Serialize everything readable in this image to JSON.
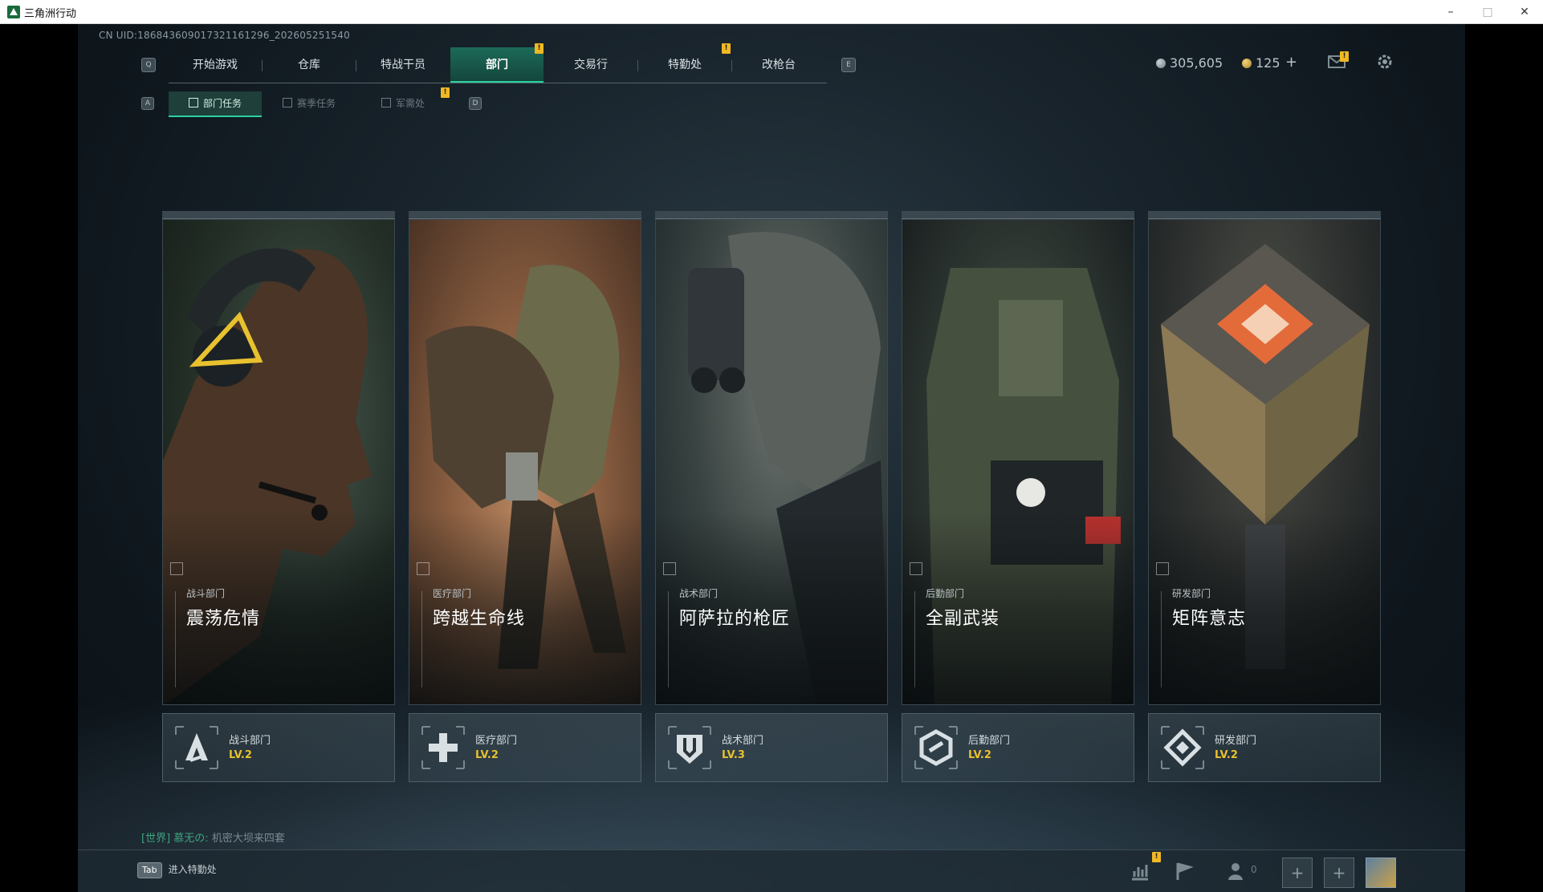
{
  "window": {
    "title": "三角洲行动",
    "minimize": "–",
    "maximize": "□",
    "close": "✕"
  },
  "uid": "CN UID:18684360901732116129​6_202605251540",
  "keyhints": {
    "left_tab": "Q",
    "right_tab": "E",
    "left_sub": "A",
    "right_sub": "D"
  },
  "tabs": [
    {
      "label": "开始游戏"
    },
    {
      "label": "仓库"
    },
    {
      "label": "特战干员"
    },
    {
      "label": "部门",
      "active": true,
      "badge": "!"
    },
    {
      "label": "交易行"
    },
    {
      "label": "特勤处",
      "badge": "!"
    },
    {
      "label": "改枪台"
    }
  ],
  "subtabs": [
    {
      "label": "部门任务",
      "active": true
    },
    {
      "label": "赛季任务"
    },
    {
      "label": "军需处",
      "badge": "!"
    }
  ],
  "currency": {
    "credits": "305,605",
    "coins": "125",
    "add": "+"
  },
  "mail_badge": "!",
  "cards": [
    {
      "dept": "战斗部门",
      "name": "震荡危情",
      "lv": "LV.2"
    },
    {
      "dept": "医疗部门",
      "name": "跨越生命线",
      "lv": "LV.2"
    },
    {
      "dept": "战术部门",
      "name": "阿萨拉的枪匠",
      "lv": "LV.3"
    },
    {
      "dept": "后勤部门",
      "name": "全副武装",
      "lv": "LV.2"
    },
    {
      "dept": "研发部门",
      "name": "矩阵意志",
      "lv": "LV.2"
    }
  ],
  "chat": {
    "channel": "[世界]",
    "sender": "慕无の:",
    "message": "机密大坝来四套"
  },
  "bottom": {
    "tab_key": "Tab",
    "tab_label": "进入特勤处",
    "friends_count": "0",
    "stats_badge": "!",
    "slot_add": "+"
  },
  "colors": {
    "accent": "#2ad1a0",
    "level": "#e8c12f",
    "badge": "#f0b823"
  }
}
